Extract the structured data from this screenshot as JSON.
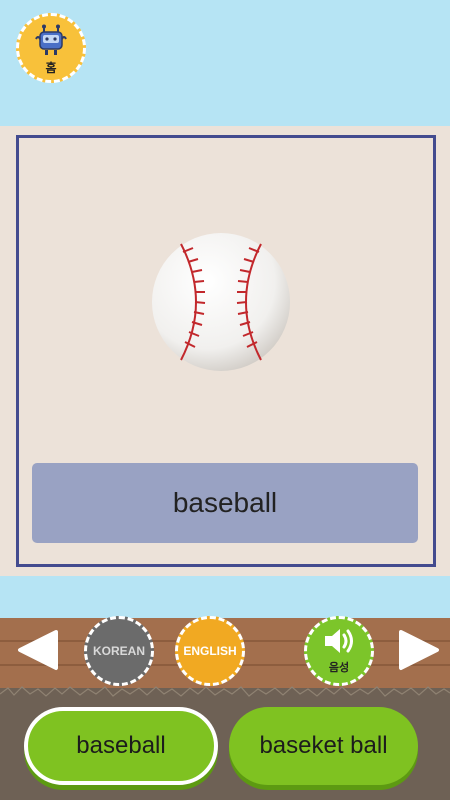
{
  "home": {
    "label": "홈",
    "icon": "robot-icon"
  },
  "card": {
    "word": "baseball",
    "image": "baseball-icon"
  },
  "controls": {
    "prev_icon": "arrow-left-icon",
    "next_icon": "arrow-right-icon",
    "korean_label": "KOREAN",
    "english_label": "ENGLISH",
    "sound_label": "음성",
    "sound_icon": "speaker-icon"
  },
  "answers": [
    {
      "label": "baseball"
    },
    {
      "label": "baseket ball"
    }
  ],
  "colors": {
    "sky": "#b6e4f4",
    "card_bg": "#ece2d9",
    "frame": "#434b8f",
    "word_box": "#99a2c3",
    "home": "#f8c13a",
    "korean": "#6b6b6b",
    "english": "#f1a922",
    "sound": "#7cc52a",
    "answer": "#7fc221"
  }
}
